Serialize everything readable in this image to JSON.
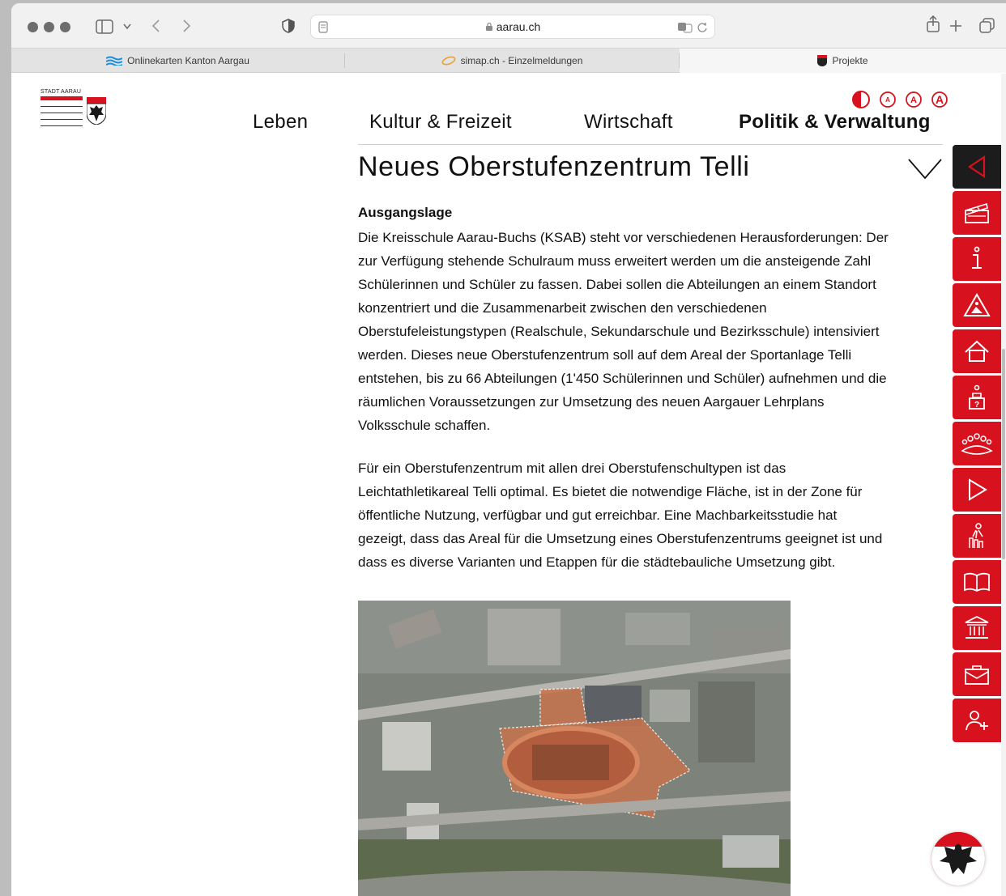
{
  "browser": {
    "url": "aarau.ch",
    "tabs": [
      {
        "label": "Onlinekarten Kanton Aargau",
        "active": false
      },
      {
        "label": "simap.ch - Einzelmeldungen",
        "active": false
      },
      {
        "label": "Projekte",
        "active": true
      }
    ]
  },
  "site": {
    "logo_text": "STADT AARAU",
    "brand_color": "#d8111e",
    "nav": [
      "Leben",
      "Kultur & Freizeit",
      "Wirtschaft",
      "Politik & Verwaltung"
    ],
    "accessibility": [
      "contrast-icon",
      "font-size-small-icon",
      "font-size-medium-icon",
      "font-size-large-icon"
    ]
  },
  "article": {
    "title": "Neues Oberstufenzentrum Telli",
    "section_heading": "Ausgangslage",
    "paragraph1_lines": [
      "Die Kreisschule Aarau-Buchs (KSAB) steht vor verschiedenen Herausforderungen: Der",
      "zur Verfügung stehende Schulraum muss erweitert werden um die ansteigende Zahl",
      "Schülerinnen und Schüler zu fassen. Dabei sollen die Abteilungen an einem Standort",
      "konzentriert und die Zusammenarbeit zwischen den verschiedenen",
      "Oberstufeleistungstypen (Realschule, Sekundarschule und Bezirksschule) intensiviert",
      "werden. Dieses neue Oberstufenzentrum soll auf dem Areal der Sportanlage Telli",
      "entstehen, bis zu 66 Abteilungen (1'450 Schülerinnen und Schüler) aufnehmen und die",
      "räumlichen Voraussetzungen zur Umsetzung des neuen Aargauer Lehrplans",
      "Volksschule schaffen."
    ],
    "paragraph2_lines": [
      "Für ein Oberstufenzentrum mit allen drei Oberstufenschultypen ist das",
      "Leichtathletikareal Telli optimal. Es bietet die notwendige Fläche, ist in der Zone für",
      "öffentliche Nutzung, verfügbar und gut erreichbar. Eine Machbarkeitsstudie hat",
      "gezeigt, dass das Areal für die Umsetzung eines Oberstufenzentrums geeignet ist und",
      "dass es diverse Varianten und Etappen für die städtebauliche Umsetzung gibt."
    ]
  },
  "sidebar": [
    "collapse-icon",
    "clapperboard-icon",
    "info-icon",
    "construction-sign-icon",
    "home-icon",
    "question-box-icon",
    "community-icon",
    "play-icon",
    "person-stairs-icon",
    "book-icon",
    "museum-icon",
    "briefcase-icon",
    "add-person-icon"
  ]
}
